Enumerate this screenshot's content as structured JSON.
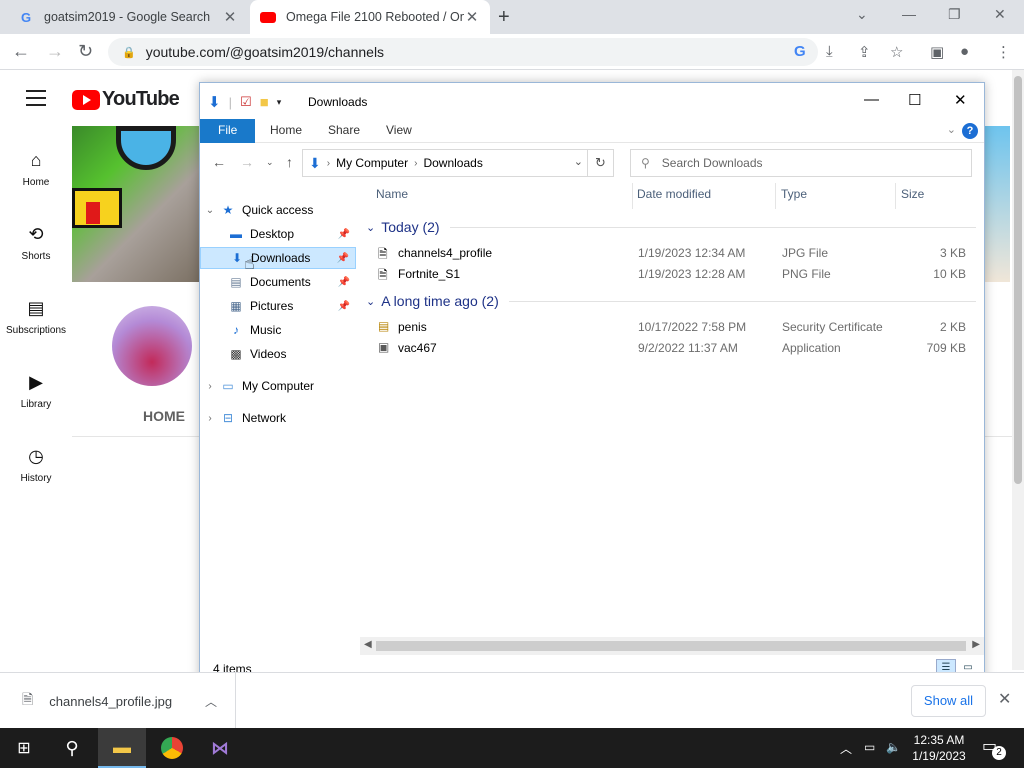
{
  "browser": {
    "tabs": [
      {
        "title": "goatsim2019 - Google Search",
        "favicon": "google-icon"
      },
      {
        "title": "Omega File 2100 Rebooted / Om",
        "favicon": "youtube-icon"
      }
    ],
    "url": "youtube.com/@goatsim2019/channels"
  },
  "youtube": {
    "logo_text": "YouTube",
    "sidebar": [
      {
        "label": "Home",
        "icon": "home-icon"
      },
      {
        "label": "Shorts",
        "icon": "shorts-icon"
      },
      {
        "label": "Subscriptions",
        "icon": "subscriptions-icon"
      },
      {
        "label": "Library",
        "icon": "library-icon"
      },
      {
        "label": "History",
        "icon": "history-icon"
      }
    ],
    "channel_tab": "HOME"
  },
  "explorer": {
    "title": "Downloads",
    "ribbon_tabs": [
      "File",
      "Home",
      "Share",
      "View"
    ],
    "breadcrumb": [
      "My Computer",
      "Downloads"
    ],
    "search_placeholder": "Search Downloads",
    "nav": {
      "quick_access": "Quick access",
      "items": [
        "Desktop",
        "Downloads",
        "Documents",
        "Pictures",
        "Music",
        "Videos"
      ],
      "my_computer": "My Computer",
      "network": "Network"
    },
    "columns": [
      "Name",
      "Date modified",
      "Type",
      "Size"
    ],
    "groups": [
      {
        "label": "Today (2)",
        "files": [
          {
            "name": "channels4_profile",
            "date": "1/19/2023 12:34 AM",
            "type": "JPG File",
            "size": "3 KB"
          },
          {
            "name": "Fortnite_S1",
            "date": "1/19/2023 12:28 AM",
            "type": "PNG File",
            "size": "10 KB"
          }
        ]
      },
      {
        "label": "A long time ago (2)",
        "files": [
          {
            "name": "penis",
            "date": "10/17/2022 7:58 PM",
            "type": "Security Certificate",
            "size": "2 KB"
          },
          {
            "name": "vac467",
            "date": "9/2/2022 11:37 AM",
            "type": "Application",
            "size": "709 KB"
          }
        ]
      }
    ],
    "status_count": "4 items"
  },
  "downloads_bar": {
    "file": "channels4_profile.jpg",
    "show_all": "Show all"
  },
  "taskbar": {
    "time": "12:35 AM",
    "date": "1/19/2023",
    "notifications": "2"
  }
}
